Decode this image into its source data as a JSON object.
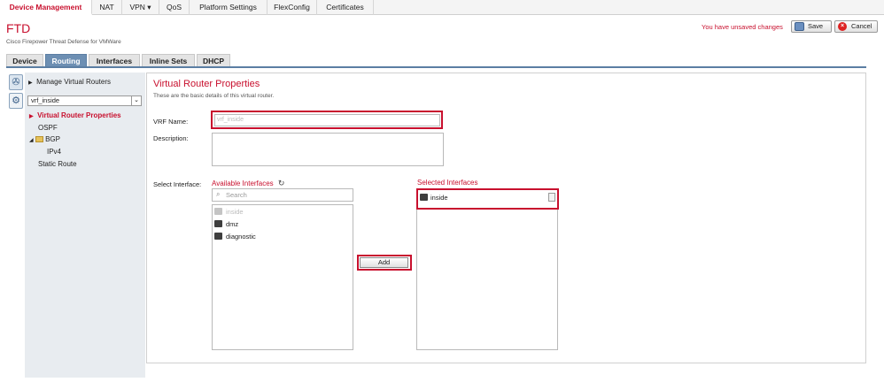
{
  "nav": {
    "items": [
      {
        "label": "Device Management",
        "active": true
      },
      {
        "label": "NAT"
      },
      {
        "label": "VPN ▾"
      },
      {
        "label": "QoS"
      },
      {
        "label": "Platform Settings"
      },
      {
        "label": "FlexConfig"
      },
      {
        "label": "Certificates"
      }
    ]
  },
  "header": {
    "title": "FTD",
    "subtitle": "Cisco Firepower Threat Defense for VMWare",
    "unsaved_text": "You have unsaved changes",
    "save_label": "Save",
    "cancel_label": "Cancel"
  },
  "tabs": [
    "Device",
    "Routing",
    "Interfaces",
    "Inline Sets",
    "DHCP"
  ],
  "sidebar": {
    "manage_label": "Manage Virtual Routers",
    "selected_router": "vrf_inside",
    "items": [
      "Virtual Router Properties",
      "OSPF",
      "BGP",
      "IPv4",
      "Static Route"
    ]
  },
  "main": {
    "heading": "Virtual Router Properties",
    "description": "These are the basic details of this virtual router.",
    "vrf_name_label": "VRF Name:",
    "vrf_name_value": "vrf_inside",
    "description_label": "Description:",
    "select_interface_label": "Select Interface:",
    "available_heading": "Available Interfaces",
    "search_placeholder": "Search",
    "available_interfaces": [
      {
        "name": "inside",
        "disabled": true
      },
      {
        "name": "dmz"
      },
      {
        "name": "diagnostic"
      }
    ],
    "add_label": "Add",
    "selected_heading": "Selected Interfaces",
    "selected_interfaces": [
      "inside"
    ]
  },
  "colors": {
    "accent": "#c8102e",
    "tab_active": "#6d8fb3"
  }
}
